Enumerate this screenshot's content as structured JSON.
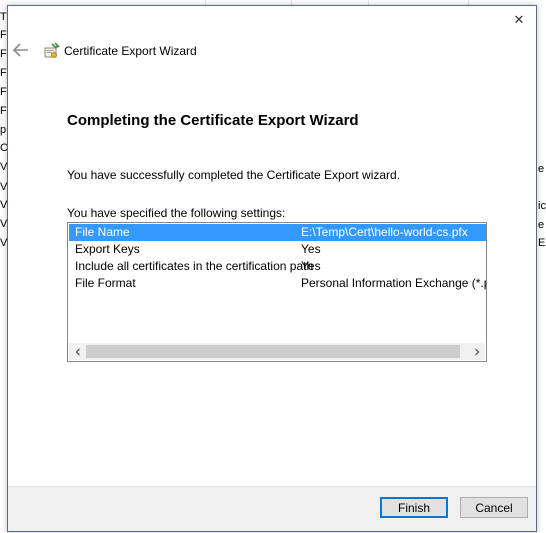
{
  "window": {
    "close_glyph": "✕",
    "wizard_name": "Certificate Export Wizard"
  },
  "page": {
    "title": "Completing the Certificate Export Wizard",
    "description": "You have successfully completed the Certificate Export wizard.",
    "settings_label": "You have specified the following settings:"
  },
  "settings": {
    "rows": [
      {
        "name": "File Name",
        "value": "E:\\Temp\\Cert\\hello-world-cs.pfx"
      },
      {
        "name": "Export Keys",
        "value": "Yes"
      },
      {
        "name": "Include all certificates in the certification path",
        "value": "Yes"
      },
      {
        "name": "File Format",
        "value": "Personal Information Exchange (*.pfx)"
      }
    ],
    "selected_index": 0
  },
  "buttons": {
    "finish": "Finish",
    "cancel": "Cancel"
  },
  "background_window": {
    "left_letters": [
      "T",
      "F",
      "F",
      "F",
      "F",
      "F",
      "p",
      "C",
      "V",
      "V",
      "V",
      "V",
      "V"
    ],
    "right_letters": [
      "e",
      "ic",
      "e",
      "E"
    ]
  },
  "colors": {
    "selection": "#3399ff",
    "accent": "#0078d7",
    "footer_bg": "#f0f0f0"
  }
}
